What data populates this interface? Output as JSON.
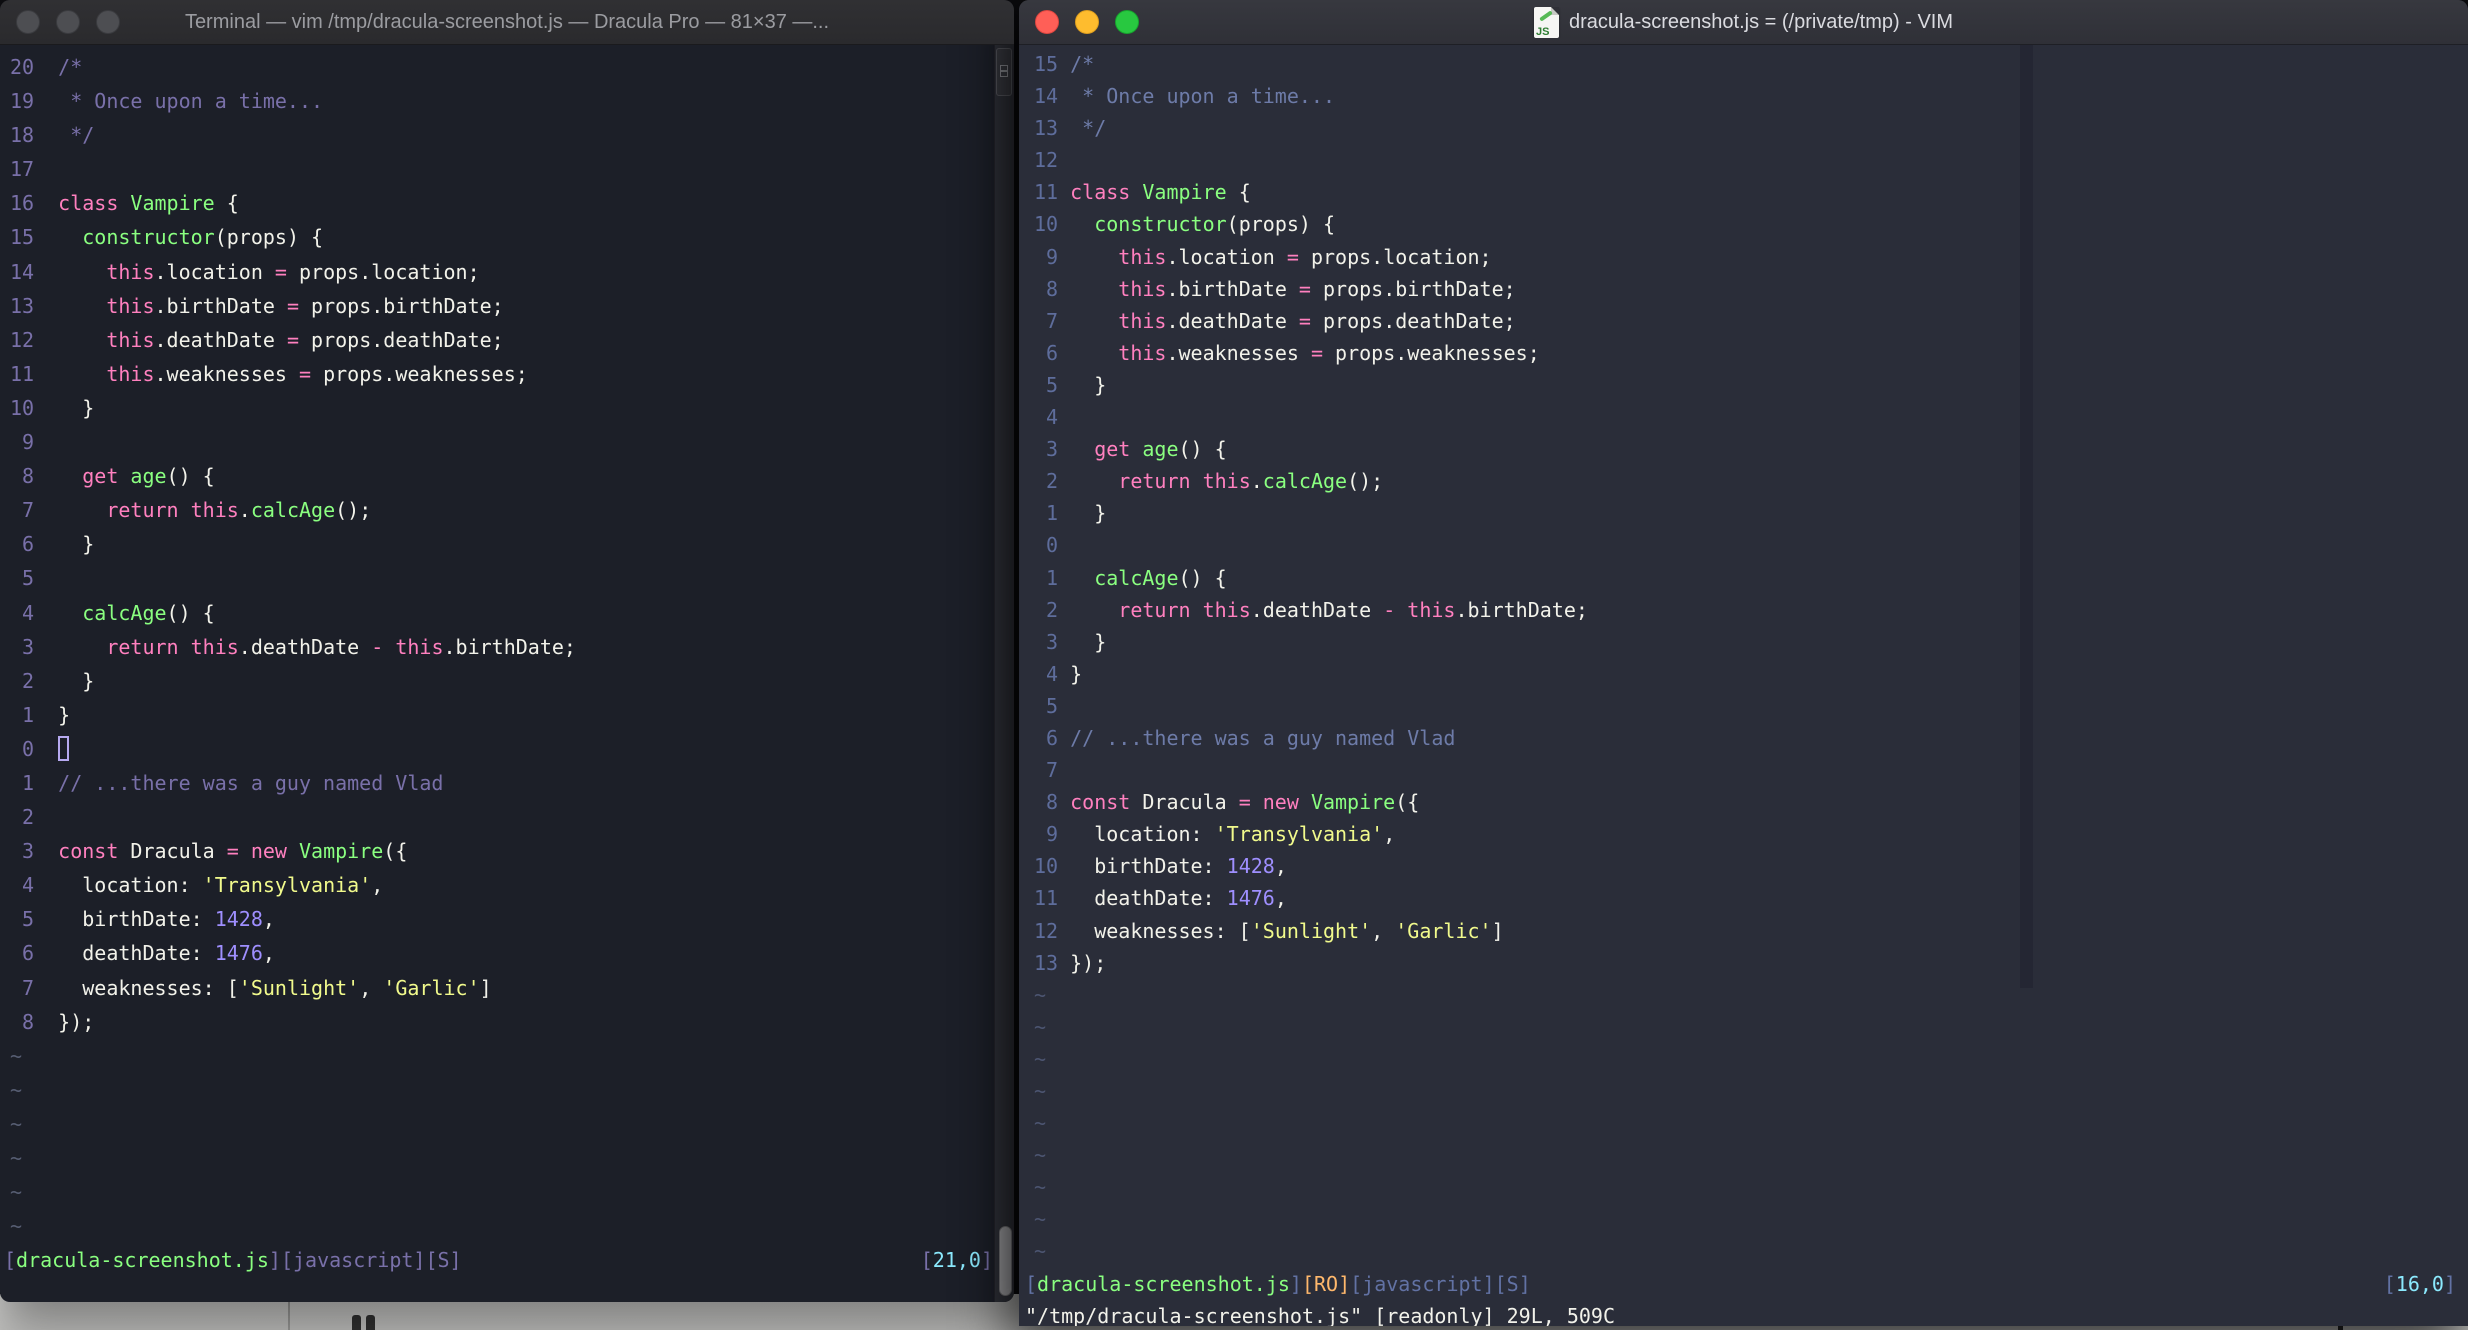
{
  "colors": {
    "fg": "#f2f2ea",
    "pink": "#ff80bf",
    "green": "#8aff80",
    "yellow": "#f1fa8c",
    "purple": "#9f8fff",
    "cyan": "#8be9fd",
    "orange": "#ffb86c"
  },
  "code": {
    "lines": [
      [
        [
          "comment",
          "/*"
        ]
      ],
      [
        [
          "comment",
          " * Once upon a time..."
        ]
      ],
      [
        [
          "comment",
          " */"
        ]
      ],
      [],
      [
        [
          "pink",
          "class "
        ],
        [
          "green",
          "Vampire"
        ],
        [
          "fg",
          " {"
        ]
      ],
      [
        [
          "fg",
          "  "
        ],
        [
          "green",
          "constructor"
        ],
        [
          "fg",
          "(props) {"
        ]
      ],
      [
        [
          "fg",
          "    "
        ],
        [
          "pink",
          "this"
        ],
        [
          "fg",
          ".location "
        ],
        [
          "pink",
          "="
        ],
        [
          "fg",
          " props.location;"
        ]
      ],
      [
        [
          "fg",
          "    "
        ],
        [
          "pink",
          "this"
        ],
        [
          "fg",
          ".birthDate "
        ],
        [
          "pink",
          "="
        ],
        [
          "fg",
          " props.birthDate;"
        ]
      ],
      [
        [
          "fg",
          "    "
        ],
        [
          "pink",
          "this"
        ],
        [
          "fg",
          ".deathDate "
        ],
        [
          "pink",
          "="
        ],
        [
          "fg",
          " props.deathDate;"
        ]
      ],
      [
        [
          "fg",
          "    "
        ],
        [
          "pink",
          "this"
        ],
        [
          "fg",
          ".weaknesses "
        ],
        [
          "pink",
          "="
        ],
        [
          "fg",
          " props.weaknesses;"
        ]
      ],
      [
        [
          "fg",
          "  }"
        ]
      ],
      [],
      [
        [
          "fg",
          "  "
        ],
        [
          "pink",
          "get "
        ],
        [
          "green",
          "age"
        ],
        [
          "fg",
          "() {"
        ]
      ],
      [
        [
          "fg",
          "    "
        ],
        [
          "pink",
          "return this"
        ],
        [
          "fg",
          "."
        ],
        [
          "green",
          "calcAge"
        ],
        [
          "fg",
          "();"
        ]
      ],
      [
        [
          "fg",
          "  }"
        ]
      ],
      [],
      [
        [
          "fg",
          "  "
        ],
        [
          "green",
          "calcAge"
        ],
        [
          "fg",
          "() {"
        ]
      ],
      [
        [
          "fg",
          "    "
        ],
        [
          "pink",
          "return this"
        ],
        [
          "fg",
          ".deathDate "
        ],
        [
          "pink",
          "-"
        ],
        [
          "fg",
          " "
        ],
        [
          "pink",
          "this"
        ],
        [
          "fg",
          ".birthDate;"
        ]
      ],
      [
        [
          "fg",
          "  }"
        ]
      ],
      [
        [
          "fg",
          "}"
        ]
      ],
      [],
      [
        [
          "comment",
          "// ...there was a guy named Vlad"
        ]
      ],
      [],
      [
        [
          "pink",
          "const "
        ],
        [
          "fg",
          "Dracula "
        ],
        [
          "pink",
          "= new "
        ],
        [
          "green",
          "Vampire"
        ],
        [
          "fg",
          "({"
        ]
      ],
      [
        [
          "fg",
          "  location: "
        ],
        [
          "yellow",
          "'Transylvania'"
        ],
        [
          "fg",
          ","
        ]
      ],
      [
        [
          "fg",
          "  birthDate: "
        ],
        [
          "purple",
          "1428"
        ],
        [
          "fg",
          ","
        ]
      ],
      [
        [
          "fg",
          "  deathDate: "
        ],
        [
          "purple",
          "1476"
        ],
        [
          "fg",
          ","
        ]
      ],
      [
        [
          "fg",
          "  weaknesses: ["
        ],
        [
          "yellow",
          "'Sunlight'"
        ],
        [
          "fg",
          ", "
        ],
        [
          "yellow",
          "'Garlic'"
        ],
        [
          "fg",
          "]"
        ]
      ],
      [
        [
          "fg",
          "});"
        ]
      ]
    ]
  },
  "window_left": {
    "title": "Terminal — vim /tmp/dracula-screenshot.js — Dracula Pro — 81×37 —...",
    "traffic_lights": [
      "close",
      "minimize",
      "zoom"
    ],
    "line_numbers": [
      "20",
      "19",
      "18",
      "17",
      "16",
      "15",
      "14",
      "13",
      "12",
      "11",
      "10",
      " 9",
      " 8",
      " 7",
      " 6",
      " 5",
      " 4",
      " 3",
      " 2",
      " 1",
      " 0",
      " 1",
      " 2",
      " 3",
      " 4",
      " 5",
      " 6",
      " 7",
      " 8"
    ],
    "cursor_row": 20,
    "tilde_count": 6,
    "statusline": [
      [
        "bracket",
        "["
      ],
      [
        "green",
        "dracula-screenshot.js"
      ],
      [
        "bracket",
        "][javascript][S]"
      ]
    ],
    "ruler": [
      [
        "bracket",
        "["
      ],
      [
        "cyan",
        "21,0"
      ],
      [
        "bracket",
        "]"
      ]
    ],
    "ruler_right": 2,
    "commandline": [],
    "colors": {
      "comment": "#7970a9",
      "linenr": "#7970a9",
      "tilde": "#565d72",
      "bracket": "#7970a9"
    }
  },
  "window_right": {
    "title": "dracula-screenshot.js = (/private/tmp) - VIM",
    "doc_icon_label": "JS",
    "traffic_lights": [
      "close",
      "minimize",
      "zoom"
    ],
    "line_numbers": [
      "15",
      "14",
      "13",
      "12",
      "11",
      "10",
      " 9",
      " 8",
      " 7",
      " 6",
      " 5",
      " 4",
      " 3",
      " 2",
      " 1",
      " 0",
      " 1",
      " 2",
      " 3",
      " 4",
      " 5",
      " 6",
      " 7",
      " 8",
      " 9",
      "10",
      "11",
      "12",
      "13"
    ],
    "cursor_row": -1,
    "tilde_count": 9,
    "statusline": [
      [
        "bracket",
        "["
      ],
      [
        "green",
        "dracula-screenshot.js"
      ],
      [
        "bracket",
        "]"
      ],
      [
        "orange",
        "[RO]"
      ],
      [
        "bracket",
        "[javascript][S]"
      ]
    ],
    "ruler": [
      [
        "bracket",
        "["
      ],
      [
        "cyan",
        "16,0"
      ],
      [
        "bracket",
        "]"
      ]
    ],
    "ruler_right": 12,
    "commandline": [
      [
        "fg",
        "\"/tmp/dracula-screenshot.js\" [readonly] 29L, 509C"
      ]
    ],
    "colors": {
      "comment": "#6d7ba8",
      "linenr": "#5e6d9c",
      "tilde": "#4c5571",
      "bracket": "#6272a4"
    }
  }
}
